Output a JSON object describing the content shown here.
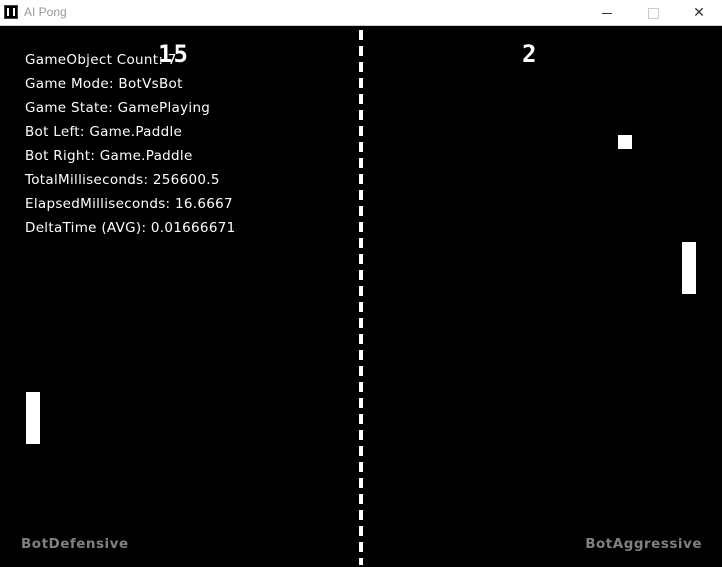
{
  "window": {
    "title": "AI Pong",
    "minimize_icon": "minimize-icon",
    "maximize_icon": "maximize-icon",
    "close_icon": "close-icon"
  },
  "scoreboard": {
    "left": "15",
    "right": "2"
  },
  "debug": {
    "lines": [
      "GameObject Count: 7",
      "Game Mode: BotVsBot",
      "Game State: GamePlaying",
      "Bot Left: Game.Paddle",
      "Bot Right: Game.Paddle",
      "TotalMilliseconds: 256600.5",
      "ElapsedMilliseconds: 16.6667",
      "DeltaTime (AVG): 0.01666671"
    ]
  },
  "bots": {
    "left": "BotDefensive",
    "right": "BotAggressive"
  },
  "colors": {
    "background": "#000000",
    "foreground": "#ffffff",
    "bot_label": "#808080"
  }
}
